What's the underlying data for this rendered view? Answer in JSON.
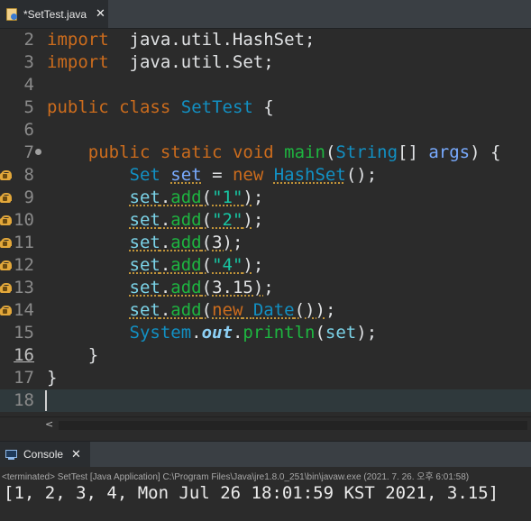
{
  "editor_tab": {
    "label": "*SetTest.java",
    "close": "✕"
  },
  "code_lines": [
    {
      "num": "2",
      "warn": false,
      "tokens": [
        [
          "k",
          "import"
        ],
        [
          "",
          "  java.util.HashSet;"
        ]
      ]
    },
    {
      "num": "3",
      "warn": false,
      "tokens": [
        [
          "k",
          "import"
        ],
        [
          "",
          "  java.util.Set;"
        ]
      ]
    },
    {
      "num": "4",
      "warn": false,
      "tokens": []
    },
    {
      "num": "5",
      "warn": false,
      "tokens": [
        [
          "k",
          "public"
        ],
        [
          "",
          " "
        ],
        [
          "k",
          "class"
        ],
        [
          "",
          " "
        ],
        [
          "t",
          "SetTest"
        ],
        [
          "",
          " {"
        ]
      ]
    },
    {
      "num": "6",
      "warn": false,
      "tokens": []
    },
    {
      "num": "7",
      "warn": false,
      "fold": true,
      "tokens": [
        [
          "",
          "    "
        ],
        [
          "k",
          "public"
        ],
        [
          "",
          " "
        ],
        [
          "k",
          "static"
        ],
        [
          "",
          " "
        ],
        [
          "k",
          "void"
        ],
        [
          "",
          " "
        ],
        [
          "m",
          "main"
        ],
        [
          "",
          "("
        ],
        [
          "t",
          "String"
        ],
        [
          "",
          "[] "
        ],
        [
          "v",
          "args"
        ],
        [
          "",
          ") {"
        ]
      ]
    },
    {
      "num": "8",
      "warn": true,
      "tokens": [
        [
          "",
          "        "
        ],
        [
          "t",
          "Set"
        ],
        [
          "",
          " "
        ],
        [
          "wv",
          "set"
        ],
        [
          "",
          " = "
        ],
        [
          "k",
          "new"
        ],
        [
          "",
          " "
        ],
        [
          "wt",
          "HashSet"
        ],
        [
          "",
          "();"
        ]
      ]
    },
    {
      "num": "9",
      "warn": true,
      "tokens": [
        [
          "",
          "        "
        ],
        [
          "wn",
          "set"
        ],
        [
          "w",
          "."
        ],
        [
          "wm",
          "add"
        ],
        [
          "w",
          "("
        ],
        [
          "ws",
          "\"1\""
        ],
        [
          "w",
          ")"
        ],
        [
          "",
          ";"
        ]
      ]
    },
    {
      "num": "10",
      "warn": true,
      "tokens": [
        [
          "",
          "        "
        ],
        [
          "wn",
          "set"
        ],
        [
          "w",
          "."
        ],
        [
          "wm",
          "add"
        ],
        [
          "w",
          "("
        ],
        [
          "ws",
          "\"2\""
        ],
        [
          "w",
          ")"
        ],
        [
          "",
          ";"
        ]
      ]
    },
    {
      "num": "11",
      "warn": true,
      "tokens": [
        [
          "",
          "        "
        ],
        [
          "wn",
          "set"
        ],
        [
          "w",
          "."
        ],
        [
          "wm",
          "add"
        ],
        [
          "w",
          "(3)"
        ],
        [
          "",
          ";"
        ]
      ]
    },
    {
      "num": "12",
      "warn": true,
      "tokens": [
        [
          "",
          "        "
        ],
        [
          "wn",
          "set"
        ],
        [
          "w",
          "."
        ],
        [
          "wm",
          "add"
        ],
        [
          "w",
          "("
        ],
        [
          "ws",
          "\"4\""
        ],
        [
          "w",
          ")"
        ],
        [
          "",
          ";"
        ]
      ]
    },
    {
      "num": "13",
      "warn": true,
      "tokens": [
        [
          "",
          "        "
        ],
        [
          "wn",
          "set"
        ],
        [
          "w",
          "."
        ],
        [
          "wm",
          "add"
        ],
        [
          "w",
          "(3.15)"
        ],
        [
          "",
          ";"
        ]
      ]
    },
    {
      "num": "14",
      "warn": true,
      "tokens": [
        [
          "",
          "        "
        ],
        [
          "wn",
          "set"
        ],
        [
          "w",
          "."
        ],
        [
          "wm",
          "add"
        ],
        [
          "w",
          "("
        ],
        [
          "wk",
          "new"
        ],
        [
          "w",
          " "
        ],
        [
          "wt",
          "Date"
        ],
        [
          "w",
          "())"
        ],
        [
          "",
          ";"
        ]
      ]
    },
    {
      "num": "15",
      "warn": false,
      "tokens": [
        [
          "",
          "        "
        ],
        [
          "t",
          "System"
        ],
        [
          "",
          "."
        ],
        [
          "sti",
          "out"
        ],
        [
          "",
          "."
        ],
        [
          "m",
          "println"
        ],
        [
          "",
          "("
        ],
        [
          "n",
          "set"
        ],
        [
          "",
          ");"
        ]
      ]
    },
    {
      "num": "16",
      "warn": false,
      "current": true,
      "tokens": [
        [
          "",
          "    }"
        ]
      ]
    },
    {
      "num": "17",
      "warn": false,
      "tokens": [
        [
          "",
          "}"
        ]
      ]
    },
    {
      "num": "18",
      "warn": false,
      "caret": true,
      "tokens": []
    }
  ],
  "hscroll": {
    "left_arrow": "<"
  },
  "console_tab": {
    "label": "Console",
    "close": "✕"
  },
  "console": {
    "terminated": "<terminated> SetTest [Java Application] C:\\Program Files\\Java\\jre1.8.0_251\\bin\\javaw.exe  (2021. 7. 26. 오후 6:01:58)",
    "output": "[1, 2, 3, 4, Mon Jul 26 18:01:59 KST 2021, 3.15]"
  },
  "colors": {
    "keyword": "#cc6c1d",
    "type": "#1290c3",
    "method": "#1eb540",
    "string": "#17c6a3",
    "background": "#2b2b2b"
  }
}
